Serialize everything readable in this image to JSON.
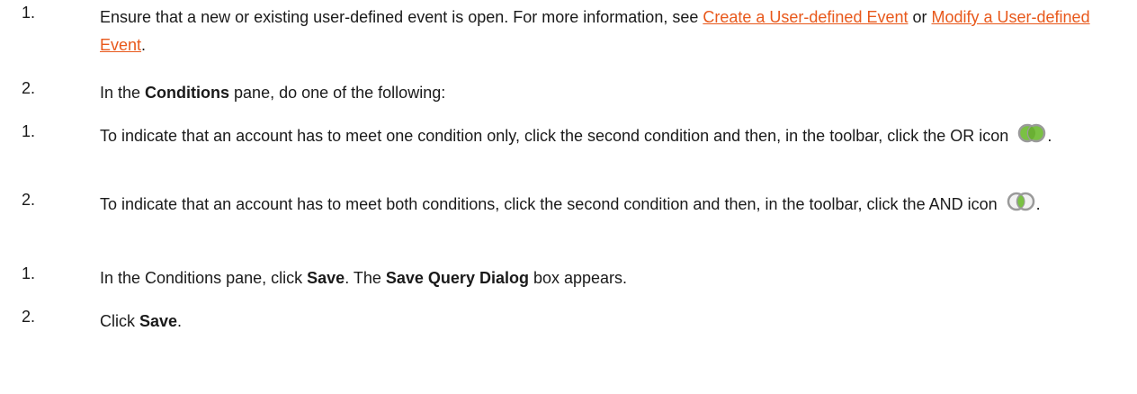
{
  "steps": [
    {
      "number": "1.",
      "pre": "Ensure that a new or existing user-defined event is open. For more information, see ",
      "link1": "Create a User-defined Event",
      "mid": " or ",
      "link2": "Modify a User-defined Event",
      "post": "."
    },
    {
      "number": "2.",
      "pre": "In the ",
      "bold": "Conditions",
      "post": " pane, do one of the following:"
    },
    {
      "number": "1.",
      "text": "To indicate that an account has to meet one condition only, click the second condition and then, in the toolbar, click the OR icon",
      "post": ".",
      "icon": "or-venn-icon"
    },
    {
      "number": "2.",
      "text": "To indicate that an account has to meet both conditions, click the second condition and then, in the toolbar, click the AND icon",
      "post": ".",
      "icon": "and-venn-icon"
    },
    {
      "number": "1.",
      "pre": "In the Conditions pane, click ",
      "bold1": "Save",
      "mid": ". The ",
      "bold2": "Save Query Dialog",
      "post": " box appears."
    },
    {
      "number": "2.",
      "pre": "Click ",
      "bold": "Save",
      "post": "."
    }
  ],
  "colors": {
    "link": "#e8581b",
    "text": "#1a1a1a",
    "venn_ring": "#9a9a9a",
    "venn_fill": "#7ac143"
  }
}
